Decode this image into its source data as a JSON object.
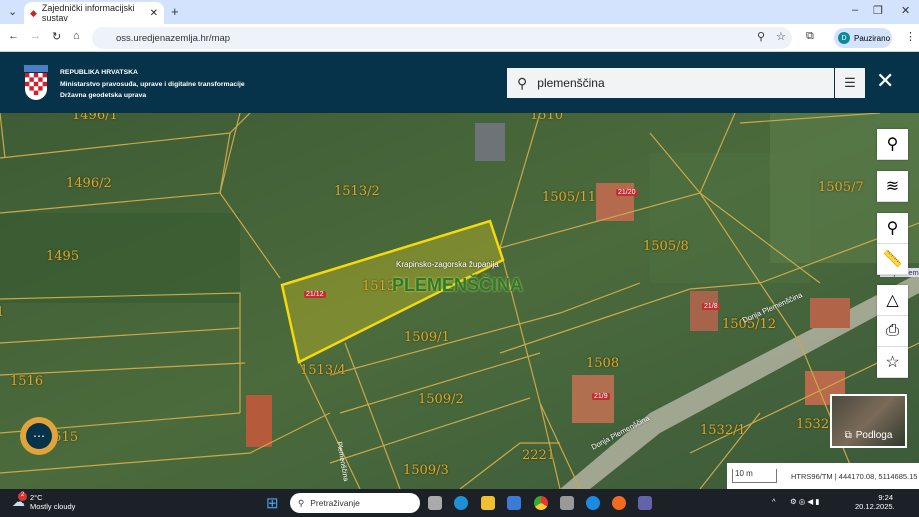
{
  "browser": {
    "tab_title": "Zajednički informacijski sustav",
    "url": "oss.uredjenazemlja.hr/map",
    "profile_initial": "D",
    "profile_label": "Pauzirano"
  },
  "header": {
    "org_line1": "REPUBLIKA HRVATSKA",
    "org_line2": "Ministarstvo pravosuđa, uprave i digitalne transformacije",
    "org_line3": "Državna geodetska uprava",
    "search_value": "plemenščina"
  },
  "map": {
    "parcels": [
      "1496/1",
      "1496/2",
      "1495",
      "1516",
      "1515",
      "1513/2",
      "1510",
      "1505/11",
      "1505/8",
      "1505/7",
      "1505/12",
      "1508",
      "1509/1",
      "1509/2",
      "1509/3",
      "1513/4",
      "2221",
      "1532/1",
      "1532",
      "1",
      "1513"
    ],
    "house_numbers": [
      "21/20",
      "21/12",
      "21/8",
      "21/9"
    ],
    "county_label": "Krapinsko-zagorska županija",
    "place_label": "PLEMENŠČINA",
    "street_label": "Donja Plemenščina",
    "street_label_short": "Donja Pleme",
    "street_vertical": "Plemenščina",
    "basemap_label": "Podloga",
    "scale": "10 m",
    "coords": "HTRS96/TM | 444170.08, 5114685.15",
    "highlight_color": "#f5d90a"
  },
  "taskbar": {
    "temp": "2°C",
    "weather": "Mostly cloudy",
    "weather_badge": "2",
    "search_placeholder": "Pretraživanje",
    "time": "9:24",
    "date": "20.12.2025."
  }
}
